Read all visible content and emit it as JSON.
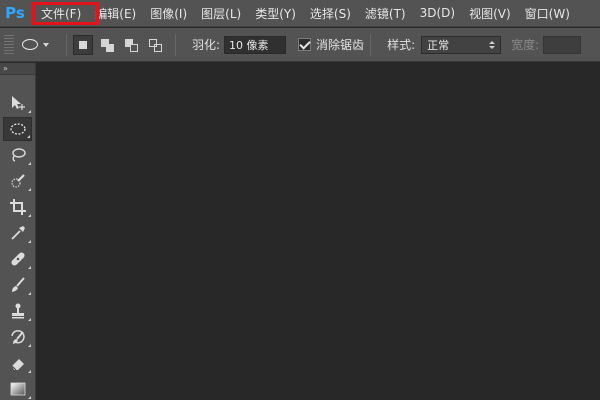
{
  "app": {
    "logo": "Ps"
  },
  "menu": [
    {
      "label": "文件(F)"
    },
    {
      "label": "编辑(E)"
    },
    {
      "label": "图像(I)"
    },
    {
      "label": "图层(L)"
    },
    {
      "label": "类型(Y)"
    },
    {
      "label": "选择(S)"
    },
    {
      "label": "滤镜(T)"
    },
    {
      "label": "3D(D)"
    },
    {
      "label": "视图(V)"
    },
    {
      "label": "窗口(W)"
    }
  ],
  "options": {
    "feather_label": "羽化:",
    "feather_value": "10 像素",
    "antialias_label": "消除锯齿",
    "antialias_checked": true,
    "style_label": "样式:",
    "style_value": "正常",
    "width_label": "宽度:"
  },
  "toolbar": {
    "collapse_glyph": "»",
    "tools": [
      {
        "icon": "move-icon"
      },
      {
        "icon": "elliptical-marquee-icon",
        "active": true
      },
      {
        "icon": "lasso-icon"
      },
      {
        "icon": "quick-selection-icon"
      },
      {
        "icon": "crop-icon"
      },
      {
        "icon": "eyedropper-icon"
      },
      {
        "icon": "healing-brush-icon"
      },
      {
        "icon": "brush-icon"
      },
      {
        "icon": "clone-stamp-icon"
      },
      {
        "icon": "history-brush-icon"
      },
      {
        "icon": "eraser-icon"
      },
      {
        "icon": "gradient-icon"
      }
    ]
  },
  "colors": {
    "highlight": "#e1141c",
    "ps_blue": "#31a8ff",
    "chrome": "#535353",
    "canvas": "#282828"
  }
}
